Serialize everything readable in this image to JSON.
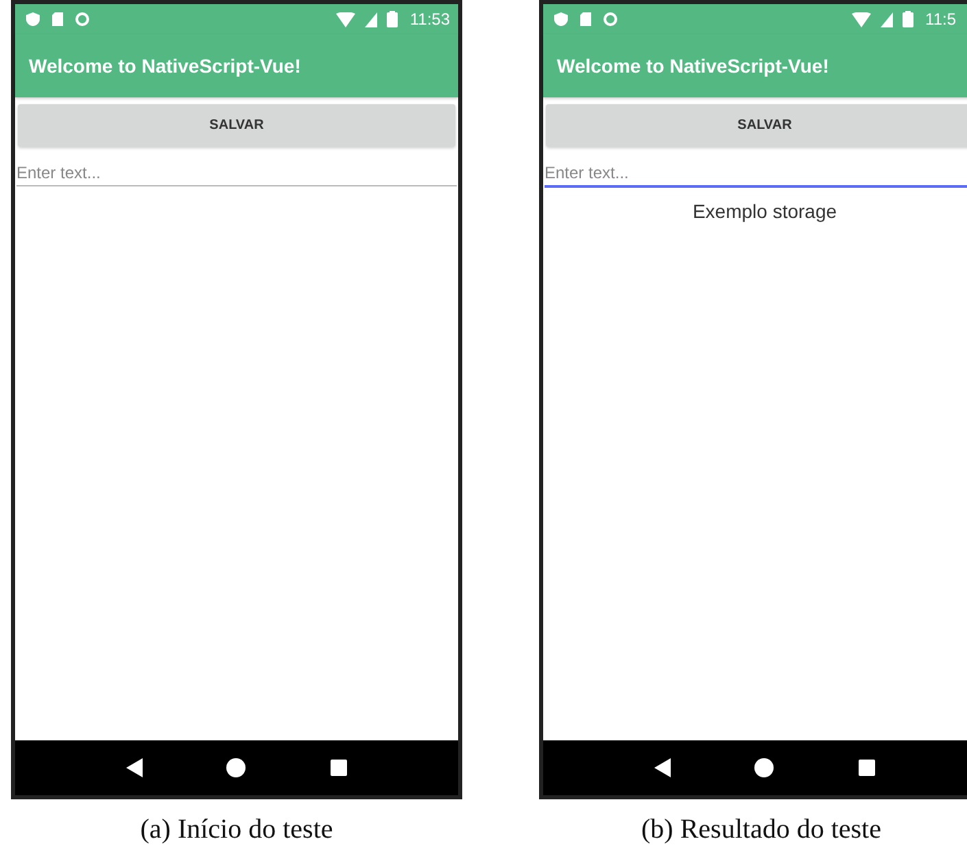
{
  "figures": [
    {
      "status_bar": {
        "time": "11:53"
      },
      "app_bar": {
        "title": "Welcome to NativeScript-Vue!"
      },
      "button": {
        "label": "SALVAR"
      },
      "text_field": {
        "placeholder": "Enter text...",
        "focused": false
      },
      "caption": "(a) Início do teste"
    },
    {
      "status_bar": {
        "time": "11:5"
      },
      "app_bar": {
        "title": "Welcome to NativeScript-Vue!"
      },
      "button": {
        "label": "SALVAR"
      },
      "text_field": {
        "placeholder": "Enter text...",
        "focused": true
      },
      "output": "Exemplo storage",
      "caption": "(b) Resultado do teste"
    }
  ]
}
